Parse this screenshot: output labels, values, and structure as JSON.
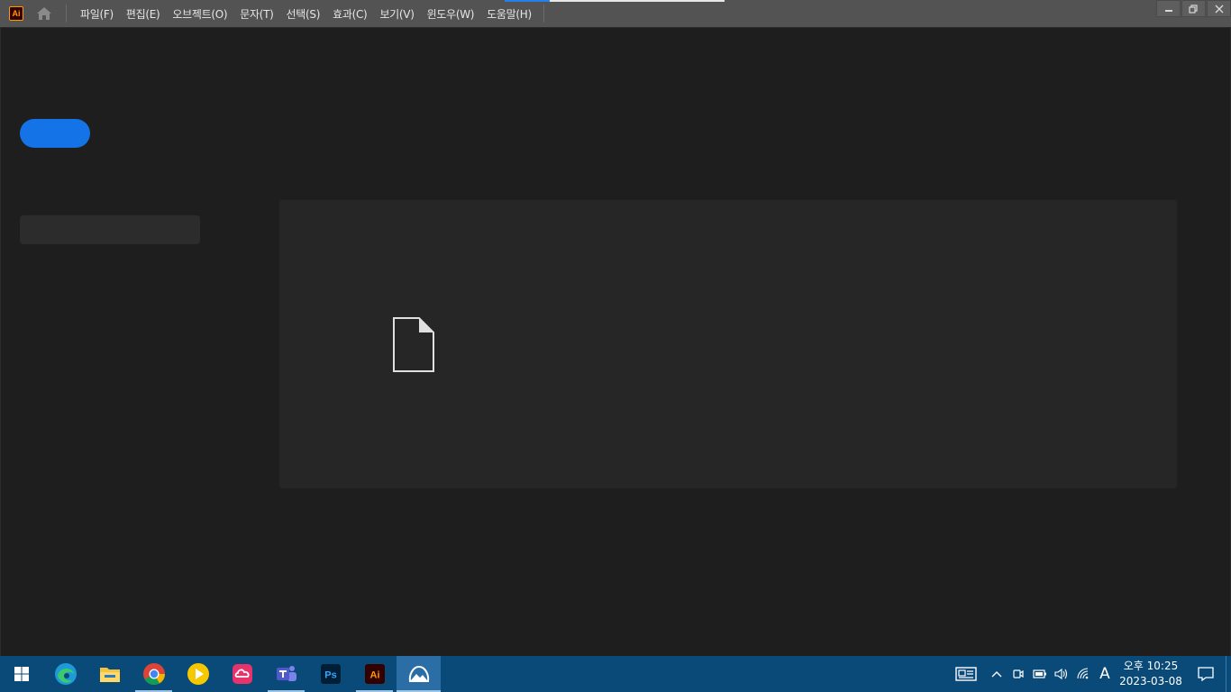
{
  "app": {
    "logo_text": "Ai",
    "logo_color": "#ff9a00"
  },
  "menu": [
    {
      "label": "파일(F)"
    },
    {
      "label": "편집(E)"
    },
    {
      "label": "오브젝트(O)"
    },
    {
      "label": "문자(T)"
    },
    {
      "label": "선택(S)"
    },
    {
      "label": "효과(C)"
    },
    {
      "label": "보기(V)"
    },
    {
      "label": "윈도우(W)"
    },
    {
      "label": "도움말(H)"
    }
  ],
  "colors": {
    "accent": "#1473e6",
    "menubar": "#535353",
    "background": "#1e1e1e",
    "taskbar": "#0a4a78"
  },
  "taskbar": {
    "apps": [
      {
        "name": "edge-icon"
      },
      {
        "name": "file-explorer-icon"
      },
      {
        "name": "chrome-icon"
      },
      {
        "name": "media-player-icon"
      },
      {
        "name": "creative-cloud-icon"
      },
      {
        "name": "teams-icon"
      },
      {
        "name": "photoshop-icon",
        "text": "Ps"
      },
      {
        "name": "illustrator-icon",
        "text": "Ai"
      },
      {
        "name": "photos-icon"
      }
    ],
    "tray": {
      "ime": "A",
      "time": "오후 10:25",
      "date": "2023-03-08"
    }
  }
}
